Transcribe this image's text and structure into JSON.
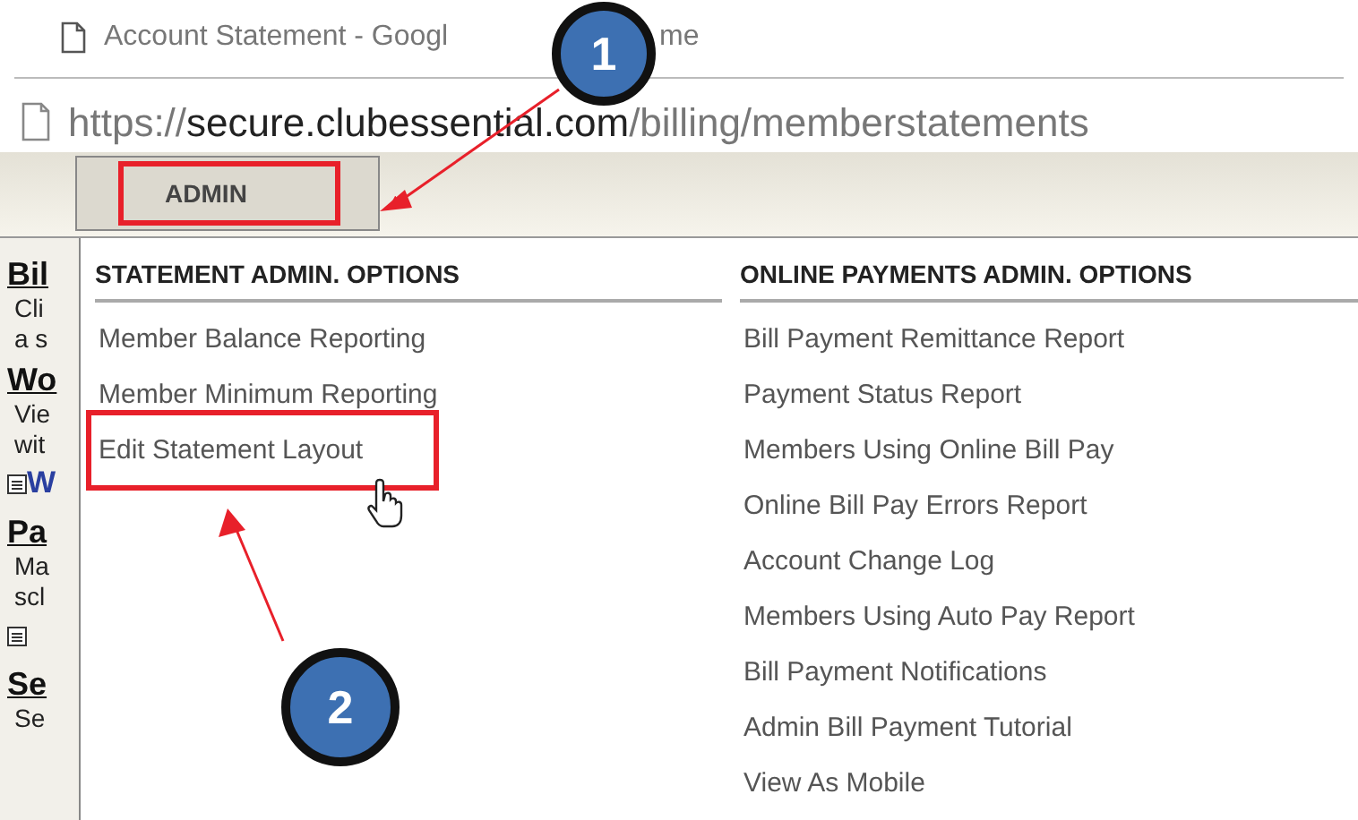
{
  "window": {
    "title_parts": [
      "Account Statement - Googl",
      "me"
    ]
  },
  "address_bar": {
    "url_parts": [
      "https://",
      "secure.clubessential.com",
      "/billing/memberstatements"
    ]
  },
  "toolbar": {
    "menu_button": {
      "label": "ADMIN",
      "highlighted": true
    }
  },
  "background_page": {
    "lines": [
      {
        "kind": "heading",
        "text": "Bil"
      },
      {
        "kind": "text",
        "text": "Cli"
      },
      {
        "kind": "text",
        "text": "a s"
      },
      {
        "kind": "heading",
        "text": "Wo"
      },
      {
        "kind": "text",
        "text": "Vie"
      },
      {
        "kind": "text",
        "text": "wit"
      },
      {
        "kind": "link",
        "text": "W"
      },
      {
        "kind": "heading",
        "text": "Pa"
      },
      {
        "kind": "text",
        "text": "Ma"
      },
      {
        "kind": "text",
        "text": "scl"
      },
      {
        "kind": "link"
      },
      {
        "kind": "heading",
        "text": "Se"
      },
      {
        "kind": "text",
        "text": "Se"
      }
    ]
  },
  "dropdown": {
    "columns": [
      {
        "title": "STATEMENT ADMIN. OPTIONS",
        "items": [
          {
            "label": "Member Balance Reporting",
            "highlighted": false
          },
          {
            "label": "Member Minimum Reporting",
            "highlighted": false
          },
          {
            "label": "Edit Statement Layout",
            "highlighted": true
          }
        ]
      },
      {
        "title": "ONLINE PAYMENTS ADMIN. OPTIONS",
        "items": [
          {
            "label": "Bill Payment Remittance Report",
            "highlighted": false
          },
          {
            "label": "Payment Status Report",
            "highlighted": false
          },
          {
            "label": "Members Using Online Bill Pay",
            "highlighted": false
          },
          {
            "label": "Online Bill Pay Errors Report",
            "highlighted": false
          },
          {
            "label": "Account Change Log",
            "highlighted": false
          },
          {
            "label": "Members Using Auto Pay Report",
            "highlighted": false
          },
          {
            "label": "Bill Payment Notifications",
            "highlighted": false
          },
          {
            "label": "Admin Bill Payment Tutorial",
            "highlighted": false
          },
          {
            "label": "View As Mobile",
            "highlighted": false
          }
        ]
      }
    ]
  },
  "annotations": {
    "callouts": [
      {
        "number": "1"
      },
      {
        "number": "2"
      }
    ]
  }
}
